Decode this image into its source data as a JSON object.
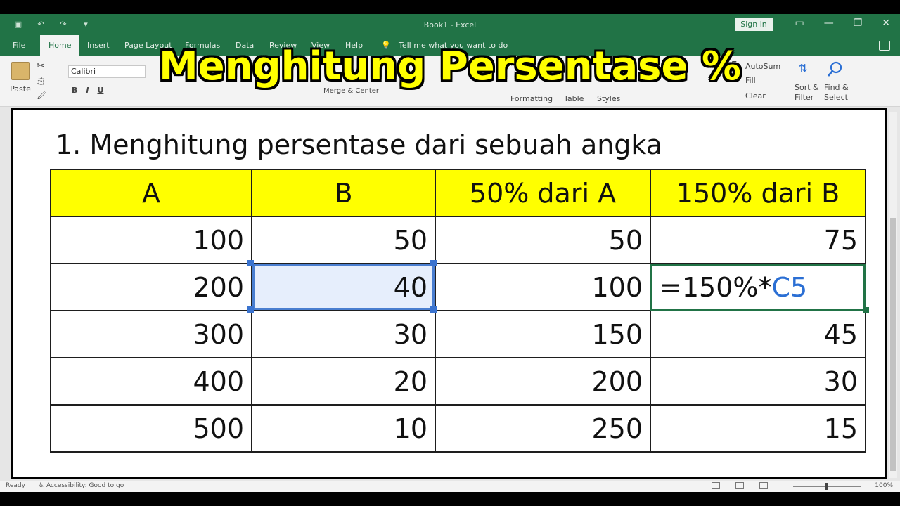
{
  "window": {
    "title": "Book1  -  Excel",
    "signin": "Sign in"
  },
  "ribbon": {
    "tabs": [
      "File",
      "Home",
      "Insert",
      "Page Layout",
      "Formulas",
      "Data",
      "Review",
      "View",
      "Help"
    ],
    "tell_me": "Tell me what you want to do",
    "paste": "Paste",
    "font_name": "Calibri",
    "bold": "B",
    "italic": "I",
    "underline": "U",
    "merge_center": "Merge & Center",
    "autosum": "AutoSum",
    "fill": "Fill",
    "clear": "Clear",
    "formatting": "Formatting",
    "table": "Table",
    "styles": "Styles",
    "sort_filter": "Sort & Filter",
    "find_select": "Find & Select"
  },
  "headline": "Menghitung Persentase %",
  "section_title": "1. Menghitung persentase dari sebuah angka",
  "table": {
    "headers": [
      "A",
      "B",
      "50% dari A",
      "150% dari B"
    ],
    "rows": [
      [
        "100",
        "50",
        "50",
        "75"
      ],
      [
        "200",
        "40",
        "100",
        ""
      ],
      [
        "300",
        "30",
        "150",
        "45"
      ],
      [
        "400",
        "20",
        "200",
        "30"
      ],
      [
        "500",
        "10",
        "250",
        "15"
      ]
    ],
    "formula_prefix": "=150%*",
    "formula_ref": "C5"
  },
  "status": {
    "ready": "Ready",
    "accessibility": "Accessibility: Good to go",
    "zoom": "100%"
  },
  "colors": {
    "excel_green": "#217346",
    "header_yellow": "#ffff00",
    "ref_blue": "#2b6fd4"
  }
}
